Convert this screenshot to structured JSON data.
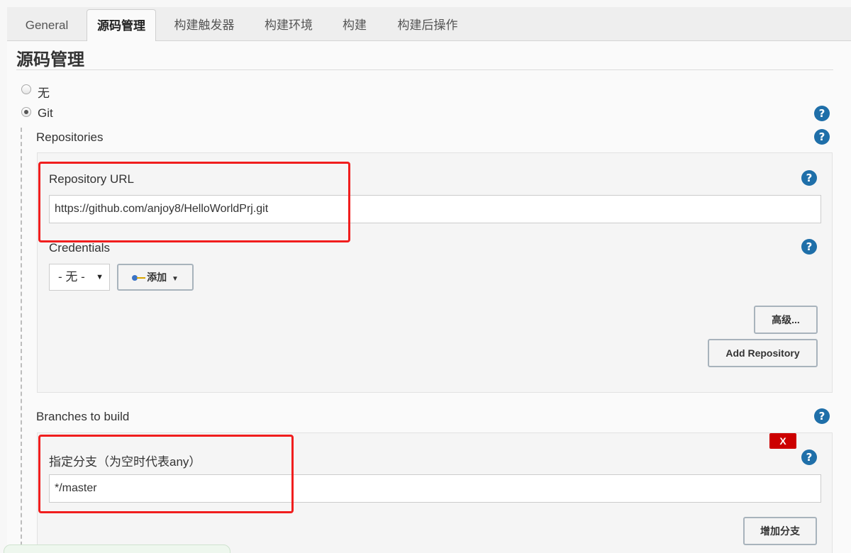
{
  "tabs": [
    {
      "label": "General",
      "active": false
    },
    {
      "label": "源码管理",
      "active": true
    },
    {
      "label": "构建触发器",
      "active": false
    },
    {
      "label": "构建环境",
      "active": false
    },
    {
      "label": "构建",
      "active": false
    },
    {
      "label": "构建后操作",
      "active": false
    }
  ],
  "scm": {
    "section_title": "源码管理",
    "option_none": "无",
    "option_git": "Git",
    "selected": "Git",
    "help_icon": "question-circle-icon"
  },
  "repositories": {
    "label": "Repositories",
    "url_label": "Repository URL",
    "url_value": "https://github.com/anjoy8/HelloWorldPrj.git",
    "credentials_label": "Credentials",
    "credentials_selected": "- 无 -",
    "add_button": "添加",
    "advanced_button": "高级...",
    "add_repository_button": "Add Repository"
  },
  "branches": {
    "label": "Branches to build",
    "delete_button": "X",
    "specifier_label": "指定分支（为空时代表any）",
    "specifier_value": "*/master",
    "add_branch_button": "增加分支"
  },
  "colors": {
    "accent_help": "#1f6fa9",
    "highlight_box": "#f01e1e",
    "delete_red": "#cc0000"
  }
}
